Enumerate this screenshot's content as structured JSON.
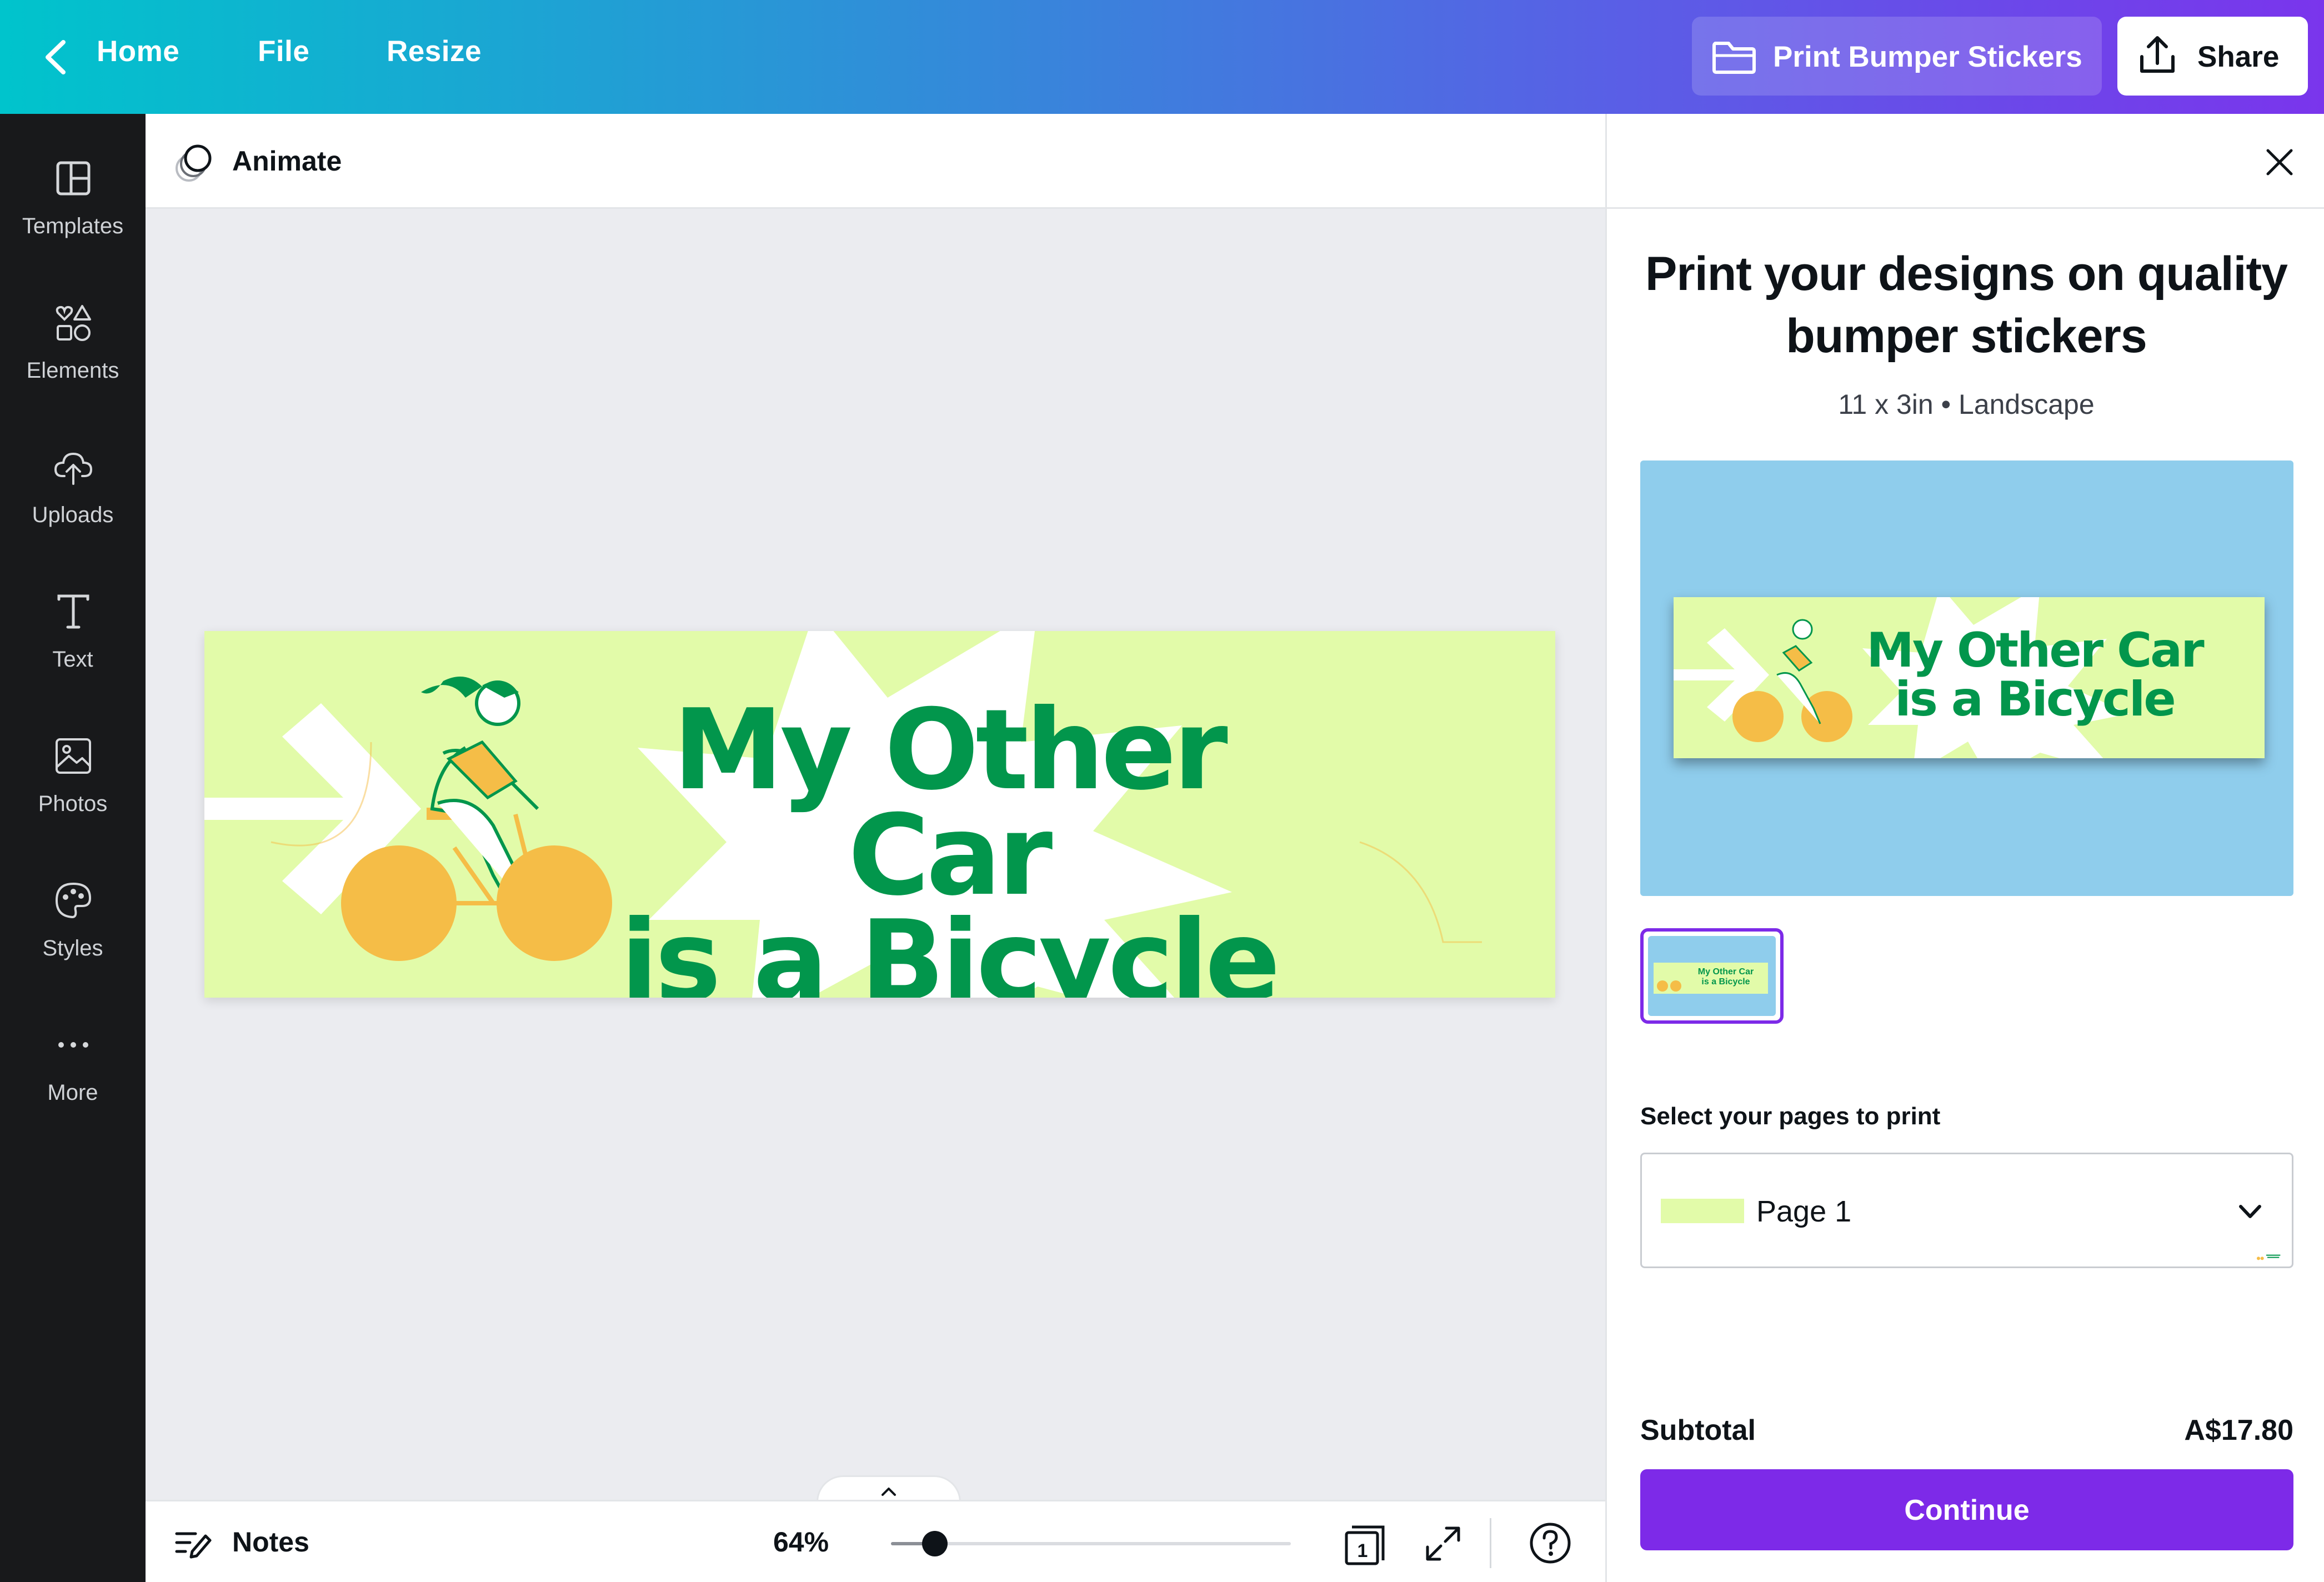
{
  "topbar": {
    "home_label": "Home",
    "file_label": "File",
    "resize_label": "Resize",
    "print_label": "Print Bumper Stickers",
    "share_label": "Share"
  },
  "sidebar": {
    "items": [
      {
        "label": "Templates",
        "icon": "templates-icon"
      },
      {
        "label": "Elements",
        "icon": "elements-icon"
      },
      {
        "label": "Uploads",
        "icon": "uploads-icon"
      },
      {
        "label": "Text",
        "icon": "text-icon"
      },
      {
        "label": "Photos",
        "icon": "photos-icon"
      },
      {
        "label": "Styles",
        "icon": "styles-icon"
      },
      {
        "label": "More",
        "icon": "more-icon"
      }
    ]
  },
  "toolbar": {
    "animate_label": "Animate"
  },
  "design": {
    "line1": "My Other Car",
    "line2": "is a Bicycle",
    "background_color": "#e2fba9",
    "text_color": "#02964c",
    "wheel_color": "#f5bd47"
  },
  "bottombar": {
    "notes_label": "Notes",
    "zoom_label": "64%",
    "zoom_fraction": 0.11,
    "page_count": "1"
  },
  "panel": {
    "title": "Print your designs on quality bumper stickers",
    "subtitle": "11 x 3in • Landscape",
    "select_label": "Select your pages to print",
    "selected_page": "Page 1",
    "subtotal_label": "Subtotal",
    "subtotal_value": "A$17.80",
    "continue_label": "Continue",
    "accent_color": "#7d2ae8",
    "preview_bg": "#8fcdec"
  }
}
